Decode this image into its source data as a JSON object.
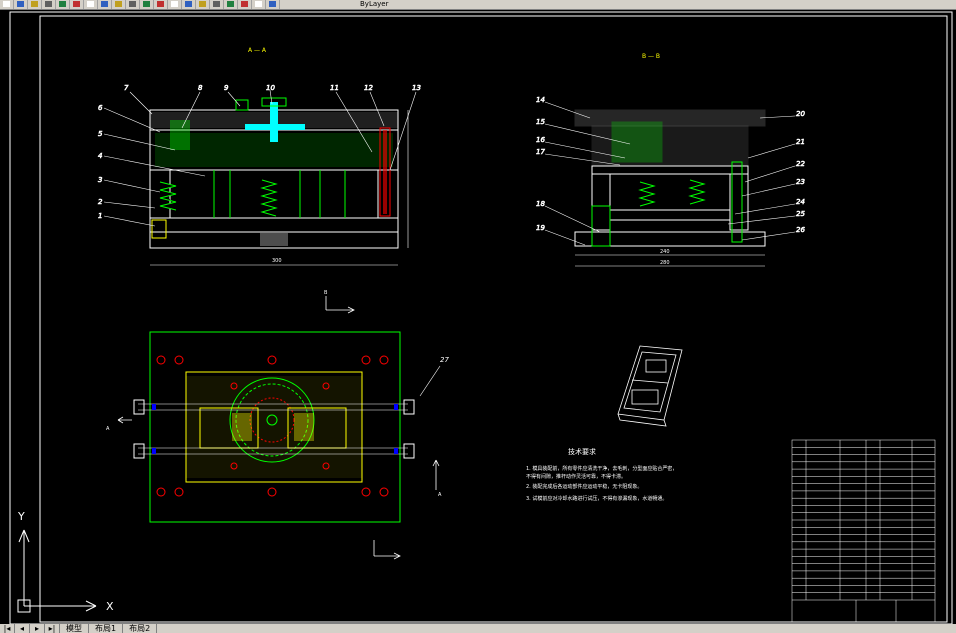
{
  "toolbar": {
    "icons": [
      "new-file-icon",
      "open-icon",
      "save-icon",
      "print-icon",
      "preview-icon",
      "cut-icon",
      "copy-icon",
      "paste-icon",
      "match-icon",
      "undo-icon",
      "redo-icon",
      "pan-icon",
      "zoom-icon",
      "zoom-window-icon",
      "zoom-previous-icon",
      "properties-icon",
      "design-center-icon",
      "tool-palette-icon",
      "layers-icon",
      "help-icon"
    ],
    "title": "ByLayer"
  },
  "views": {
    "section_a_label": "A — A",
    "section_b_label": "B — B"
  },
  "callouts_left": [
    "1",
    "2",
    "3",
    "4",
    "5",
    "6",
    "7",
    "8",
    "9",
    "10",
    "11",
    "12",
    "13"
  ],
  "callouts_right": [
    "14",
    "15",
    "16",
    "17",
    "18",
    "19",
    "20",
    "21",
    "22",
    "23",
    "24",
    "25",
    "26"
  ],
  "callout_plan": "27",
  "section_markers": {
    "a": "A",
    "b": "B"
  },
  "tech_requirements": {
    "title": "技术要求",
    "lines": [
      "1. 模具装配前，所有零件应清洗干净，去毛刺，分型面应贴合严密，",
      "   不得有间隙，推杆动作灵活可靠，不得卡滞。",
      "2. 装配完成后各运动部件应运动平稳，无卡阻现象。",
      "3. 试模前应对冷却水路进行试压，不得有渗漏现象，水道畅通。"
    ]
  },
  "title_block": {
    "rows": 22
  },
  "ucs": {
    "x": "X",
    "y": "Y"
  },
  "tabs": {
    "model": "模型",
    "layout1": "布局1",
    "layout2": "布局2"
  },
  "colors": {
    "background": "#000000",
    "frame": "#ffffff",
    "green": "#00ff00",
    "yellow": "#ffff00",
    "cyan": "#00ffff",
    "red": "#ff0000",
    "magenta": "#ff00ff"
  }
}
